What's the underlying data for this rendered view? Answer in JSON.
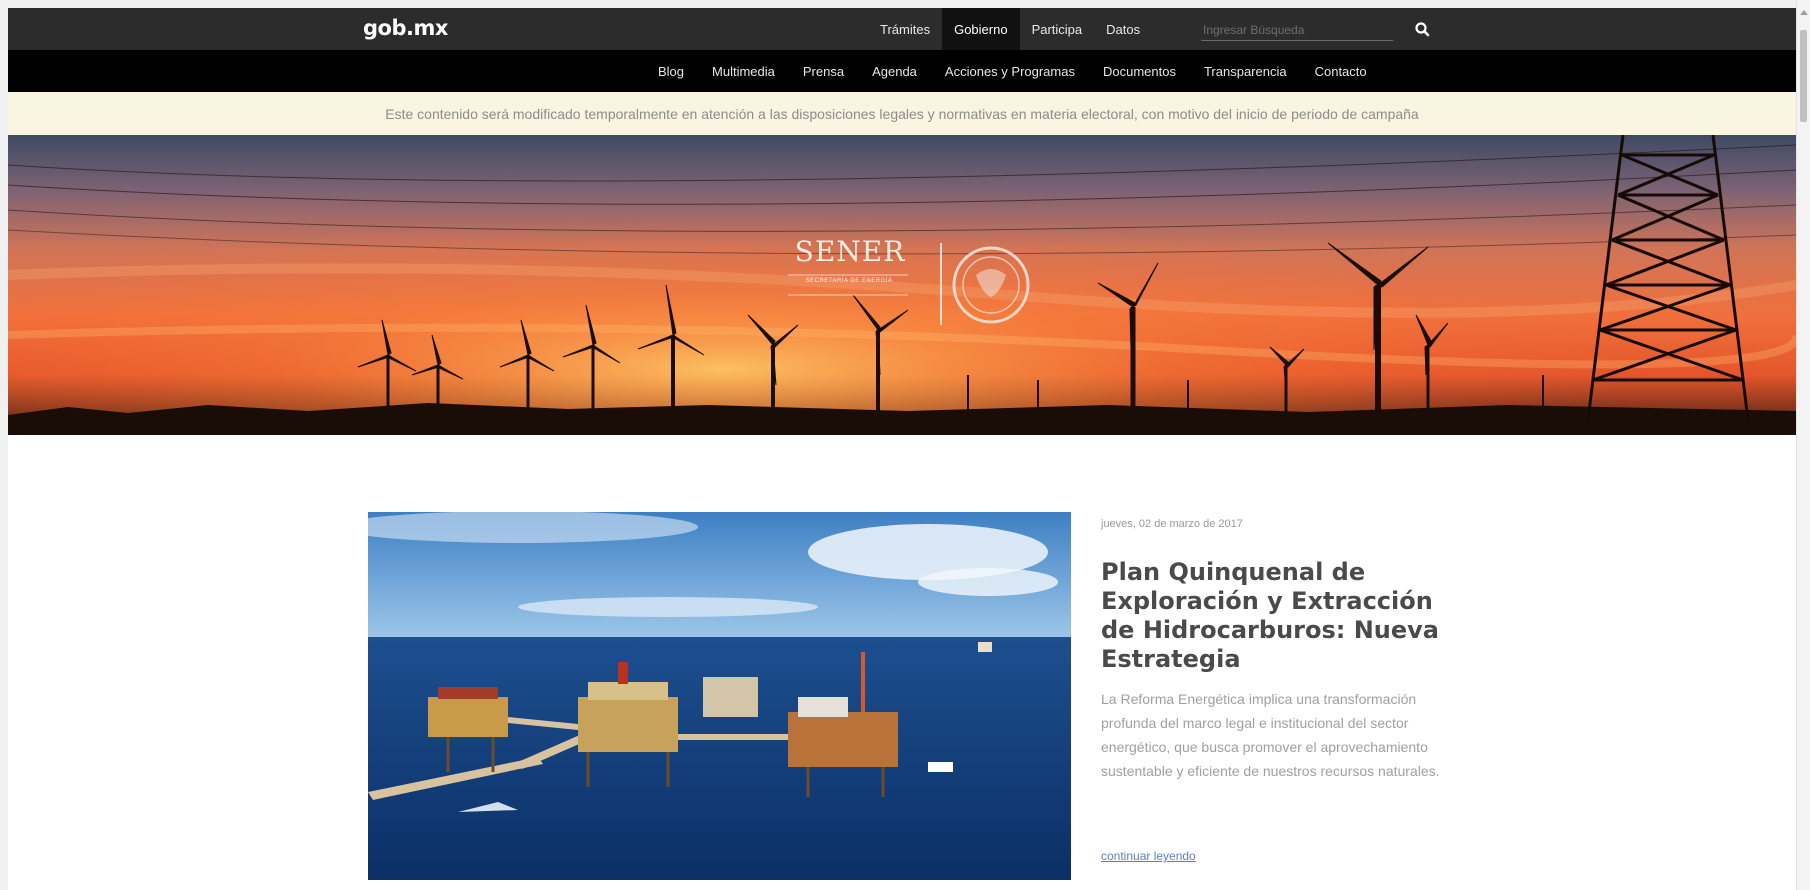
{
  "brand": {
    "logo": "gob.mx"
  },
  "topnav": {
    "items": [
      {
        "label": "Trámites"
      },
      {
        "label": "Gobierno"
      },
      {
        "label": "Participa"
      },
      {
        "label": "Datos"
      }
    ],
    "active_item": "Gobierno",
    "search_placeholder": "Ingresar Búsqueda",
    "search_icon": "search-icon"
  },
  "subnav": {
    "items": [
      {
        "label": "Blog"
      },
      {
        "label": "Multimedia"
      },
      {
        "label": "Prensa"
      },
      {
        "label": "Agenda"
      },
      {
        "label": "Acciones y Programas"
      },
      {
        "label": "Documentos"
      },
      {
        "label": "Transparencia"
      },
      {
        "label": "Contacto"
      }
    ]
  },
  "notice": {
    "text": "Este contenido será modificado temporalmente en atención a las disposiciones legales y normativas en materia electoral, con motivo del inicio de periodo de campaña"
  },
  "hero": {
    "logo_text": "SENER",
    "logo_subtext": "SECRETARÍA DE ENERGÍA"
  },
  "article": {
    "date": "jueves, 02 de marzo de 2017",
    "title": "Plan Quinquenal de Exploración y Extracción de Hidrocarburos: Nueva Estrategia",
    "description": "La Reforma Energética implica una transformación profunda del marco legal e institucional del sector energético, que busca promover el aprovechamiento sustentable y eficiente de nuestros recursos naturales.",
    "link_label": "continuar leyendo"
  },
  "colors": {
    "topnav_bg": "#2c2c2c",
    "subnav_bg": "#000000",
    "notice_bg": "#faf5e0",
    "link": "#5b7fc0"
  }
}
